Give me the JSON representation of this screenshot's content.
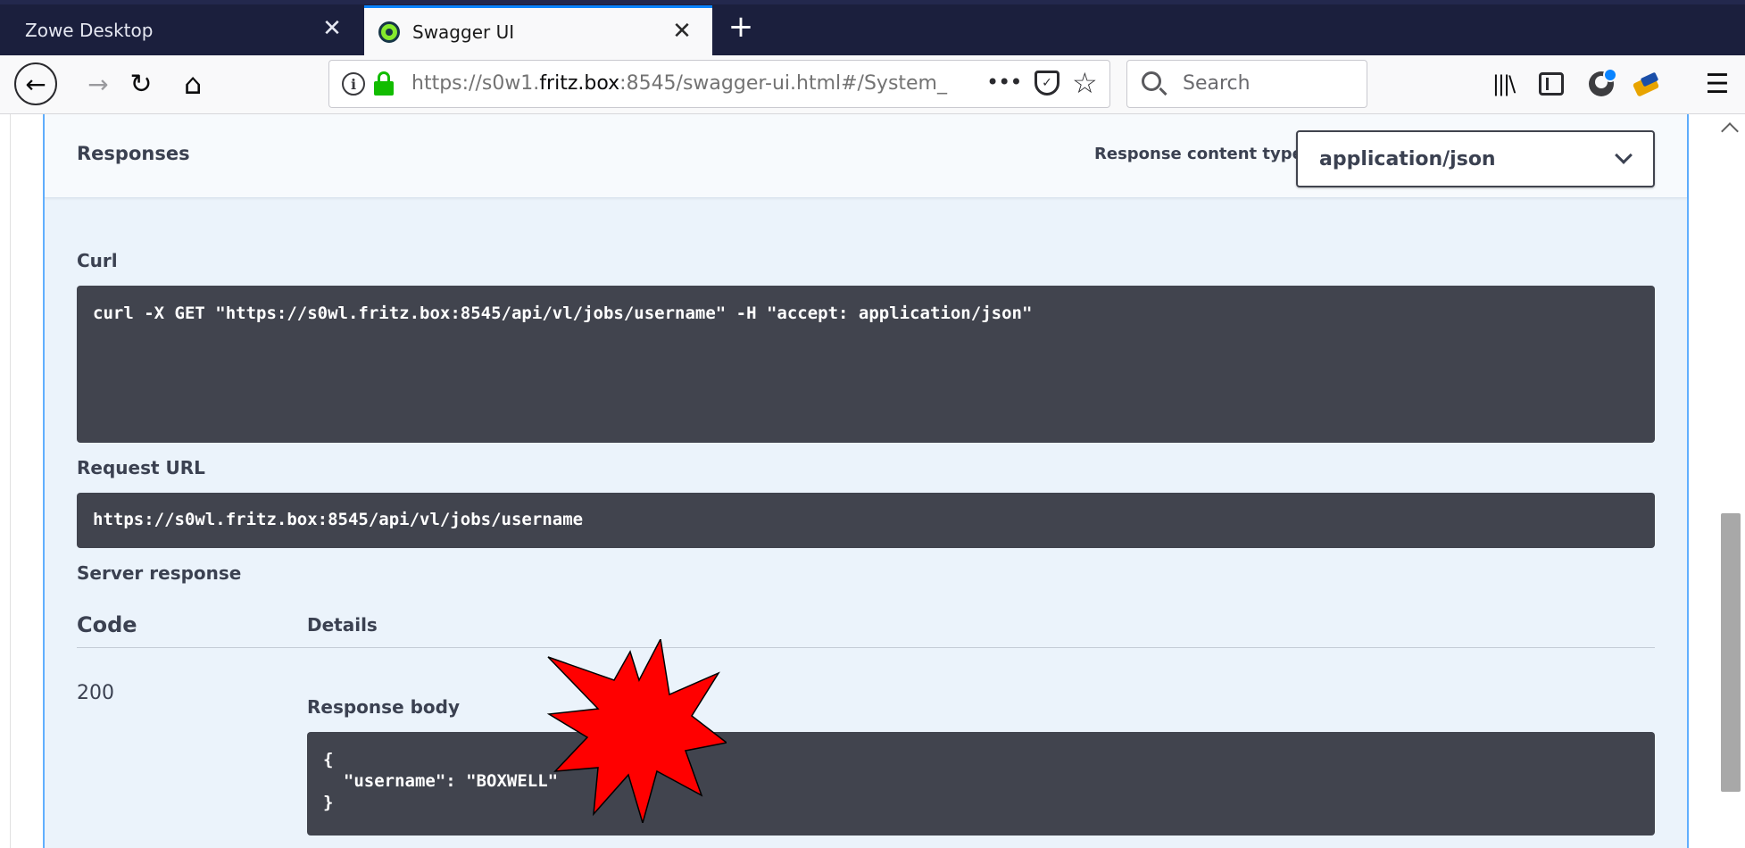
{
  "tabs": [
    {
      "title": "Zowe Desktop",
      "active": false
    },
    {
      "title": "Swagger UI",
      "active": true
    }
  ],
  "tab_close_glyph": "✕",
  "new_tab_glyph": "+",
  "toolbar": {
    "back_glyph": "←",
    "forward_glyph": "→",
    "reload_glyph": "↻",
    "home_glyph": "⌂",
    "url_prefix": "https://s0w1.",
    "url_host": "fritz.box",
    "url_suffix": ":8545/swagger-ui.html#/System_",
    "more_glyph": "•••",
    "pocket_glyph": "✓",
    "star_glyph": "☆",
    "search_placeholder": "Search",
    "library_glyph": "|||\\",
    "menu_glyph": "☰"
  },
  "responses": {
    "title": "Responses",
    "content_type_label": "Response content type",
    "content_type_value": "application/json"
  },
  "curl": {
    "label": "Curl",
    "command": "curl -X GET \"https://s0wl.fritz.box:8545/api/vl/jobs/username\" -H \"accept: application/json\""
  },
  "request_url": {
    "label": "Request URL",
    "value": "https://s0wl.fritz.box:8545/api/vl/jobs/username"
  },
  "server_response": {
    "label": "Server response",
    "col_code": "Code",
    "col_details": "Details",
    "code": "200",
    "body_label": "Response body",
    "body_lines": [
      "{",
      "  \"username\": \"BOXWELL\"",
      "}"
    ]
  },
  "colors": {
    "tab_strip": "#1b1f3d",
    "get_accent": "#61affe",
    "code_bg": "#41444e",
    "lock_green": "#12bc00",
    "starburst_fill": "#ff0000"
  }
}
